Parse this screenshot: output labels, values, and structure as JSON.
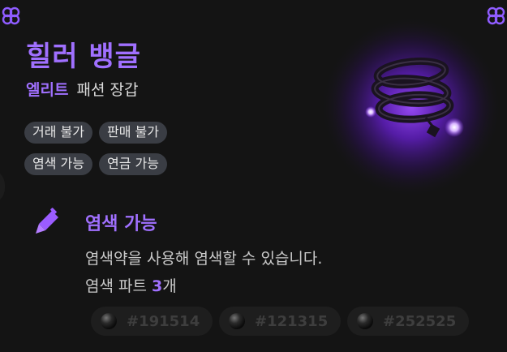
{
  "item": {
    "name": "힐러 뱅글",
    "grade": "엘리트",
    "category": "패션 장갑"
  },
  "tags": [
    "거래 불가",
    "판매 불가",
    "염색 가능",
    "연금 가능"
  ],
  "dye": {
    "title": "염색 가능",
    "description": "염색약을 사용해 염색할 수 있습니다.",
    "parts_prefix": "염색 파트 ",
    "parts_count": "3",
    "parts_suffix": "개",
    "colors": [
      "#191514",
      "#121315",
      "#252525"
    ]
  },
  "colors": {
    "accent": "#a070ff",
    "tag_bg": "#3a3d44",
    "background": "#141414"
  },
  "icons": {
    "corner": "knot-corner-icon",
    "dye": "dye-brush-icon",
    "color_dot": "color-dot-icon"
  }
}
